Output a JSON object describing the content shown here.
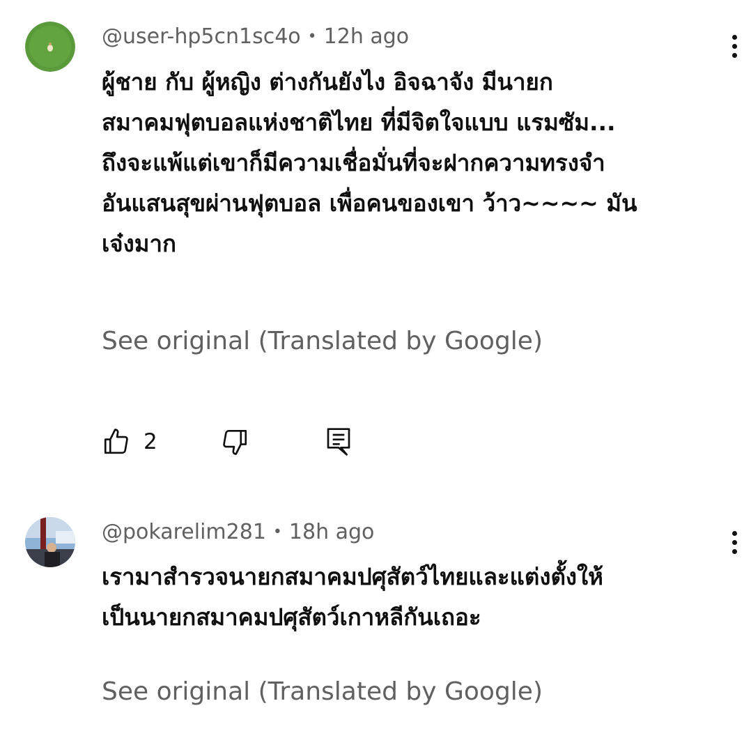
{
  "comments": [
    {
      "handle": "@user-hp5cn1sc4o",
      "time": "12h ago",
      "text": "ผู้ชาย กับ ผู้หญิง ต่างกันยังไง อิจฉาจัง มีนายก\nสมาคมฟุตบอลแห่งชาติไทย ที่มีจิตใจแบบ แรมซัม...\nถึงจะแพ้แต่เขาก็มีความเชื่อมั่นที่จะฝากความทรงจำ\nอันแสนสุขผ่านฟุตบอล เพื่อคนของเขา ว้าว~~~~ มัน\nเจ๋งมาก",
      "see_original": "See original (Translated by Google)",
      "likes": "2",
      "avatar_color": "#5a9a3a"
    },
    {
      "handle": "@pokarelim281",
      "time": "18h ago",
      "text": "เรามาสำรวจนายกสมาคมปศุสัตว์ไทยและแต่งตั้งให้\nเป็นนายกสมาคมปศุสัตว์เกาหลีกันเถอะ",
      "see_original": "See original (Translated by Google)"
    }
  ],
  "icons": {
    "like": "thumbs-up-icon",
    "dislike": "thumbs-down-icon",
    "reply": "reply-icon",
    "more": "more-vertical-icon"
  },
  "separator": "•"
}
